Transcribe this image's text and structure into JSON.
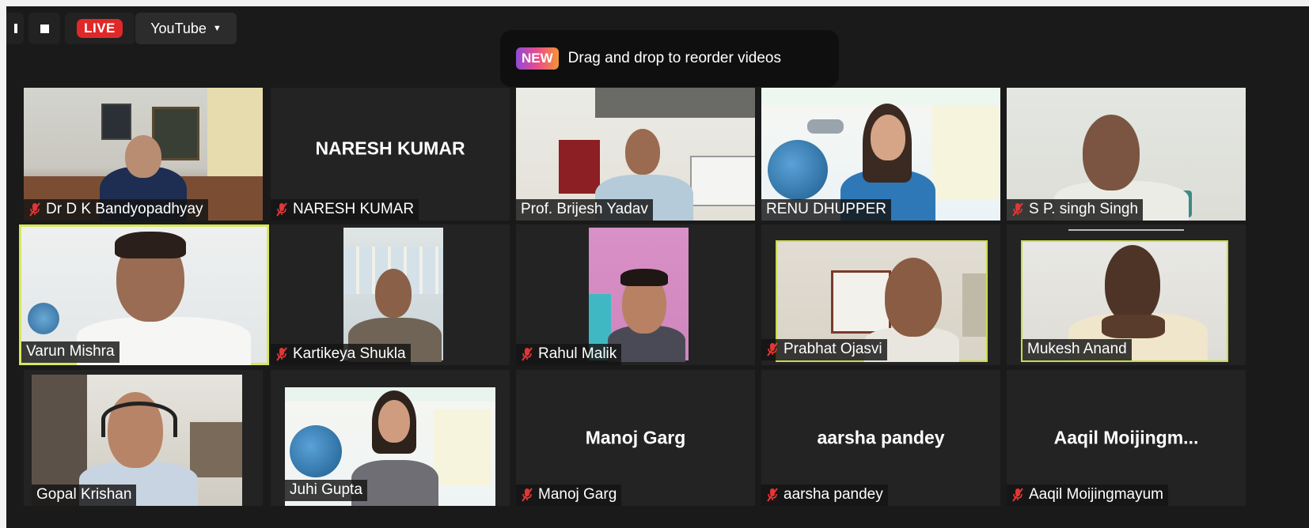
{
  "toolbar": {
    "live_label": "LIVE",
    "platform_label": "YouTube"
  },
  "banner": {
    "badge": "NEW",
    "text": "Drag and drop to reorder videos"
  },
  "participants": [
    {
      "name": "Dr D K Bandyopadhyay",
      "muted": true,
      "video": true
    },
    {
      "name": "NARESH KUMAR",
      "muted": true,
      "video": false,
      "center_label": "NARESH KUMAR"
    },
    {
      "name": "Prof. Brijesh Yadav",
      "muted": false,
      "video": true
    },
    {
      "name": "RENU DHUPPER",
      "muted": false,
      "video": true
    },
    {
      "name": "S P. singh Singh",
      "muted": true,
      "video": true
    },
    {
      "name": "Varun Mishra",
      "muted": false,
      "video": true,
      "active_speaker": true
    },
    {
      "name": "Kartikeya Shukla",
      "muted": true,
      "video": true
    },
    {
      "name": "Rahul Malik",
      "muted": true,
      "video": true
    },
    {
      "name": "Prabhat Ojasvi",
      "muted": true,
      "video": true
    },
    {
      "name": "Mukesh Anand",
      "muted": false,
      "video": true
    },
    {
      "name": "Gopal Krishan",
      "muted": false,
      "video": true
    },
    {
      "name": "Juhi Gupta",
      "muted": false,
      "video": true
    },
    {
      "name": "Manoj Garg",
      "muted": true,
      "video": false,
      "center_label": "Manoj Garg"
    },
    {
      "name": "aarsha pandey",
      "muted": true,
      "video": false,
      "center_label": "aarsha pandey"
    },
    {
      "name": "Aaqil Moijingmayum",
      "muted": true,
      "video": false,
      "center_label": "Aaqil  Moijingm..."
    }
  ],
  "colors": {
    "live": "#e02828",
    "mute": "#e23636",
    "active_border": "#d8e75a"
  }
}
